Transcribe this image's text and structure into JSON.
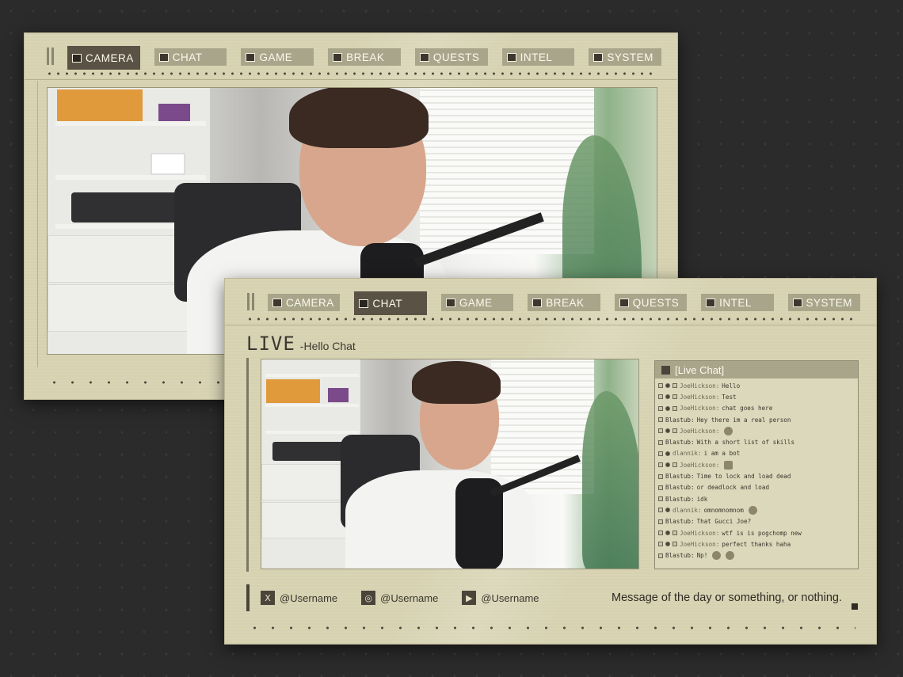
{
  "tabs": [
    {
      "label": "CAMERA",
      "icon": "camera-icon"
    },
    {
      "label": "CHAT",
      "icon": "chat-icon"
    },
    {
      "label": "GAME",
      "icon": "gamepad-icon"
    },
    {
      "label": "BREAK",
      "icon": "break-icon"
    },
    {
      "label": "QUESTS",
      "icon": "quest-icon"
    },
    {
      "label": "INTEL",
      "icon": "intel-icon"
    },
    {
      "label": "SYSTEM",
      "icon": "system-icon"
    }
  ],
  "back_panel": {
    "active_tab": "CAMERA"
  },
  "front_panel": {
    "active_tab": "CHAT",
    "live_word": "LIVE",
    "live_subtitle": "-Hello Chat",
    "chat_title": "[Live Chat]",
    "messages": [
      {
        "user": "JoeHickson:",
        "text": "Hello",
        "badges": 3
      },
      {
        "user": "JoeHickson:",
        "text": "Test",
        "badges": 3
      },
      {
        "user": "JoeHickson:",
        "text": "chat goes here",
        "badges": 3
      },
      {
        "user": "Blastub:",
        "text": "Hey there im a real person",
        "badges": 1
      },
      {
        "user": "JoeHickson:",
        "text": "",
        "badges": 3,
        "emote": "emote-face"
      },
      {
        "user": "Blastub:",
        "text": "With a short list of skills",
        "badges": 1
      },
      {
        "user": "dlannik:",
        "text": "i am a bot",
        "badges": 2
      },
      {
        "user": "JoeHickson:",
        "text": "",
        "badges": 3,
        "emote": "emote-box"
      },
      {
        "user": "Blastub:",
        "text": "Time to lock and load dead",
        "badges": 1
      },
      {
        "user": "Blastub:",
        "text": "or deadlock and load",
        "badges": 1
      },
      {
        "user": "Blastub:",
        "text": "idk",
        "badges": 1
      },
      {
        "user": "dlannik:",
        "text": "omnomnomnom",
        "badges": 2,
        "emote": "emote-bird"
      },
      {
        "user": "Blastub:",
        "text": "That Gucci Joe?",
        "badges": 1
      },
      {
        "user": "JoeHickson:",
        "text": "wtf is is pogchomp new",
        "badges": 3
      },
      {
        "user": "JoeHickson:",
        "text": "perfect thanks haha",
        "badges": 3
      },
      {
        "user": "Blastub:",
        "text": "Np!",
        "badges": 1,
        "emote": "emote-face-pair"
      }
    ],
    "socials": [
      {
        "icon": "x-icon",
        "glyph": "X",
        "handle": "@Username"
      },
      {
        "icon": "instagram-icon",
        "glyph": "◎",
        "handle": "@Username"
      },
      {
        "icon": "youtube-icon",
        "glyph": "▶",
        "handle": "@Username"
      }
    ],
    "motd": "Message of the day or something, or nothing."
  }
}
